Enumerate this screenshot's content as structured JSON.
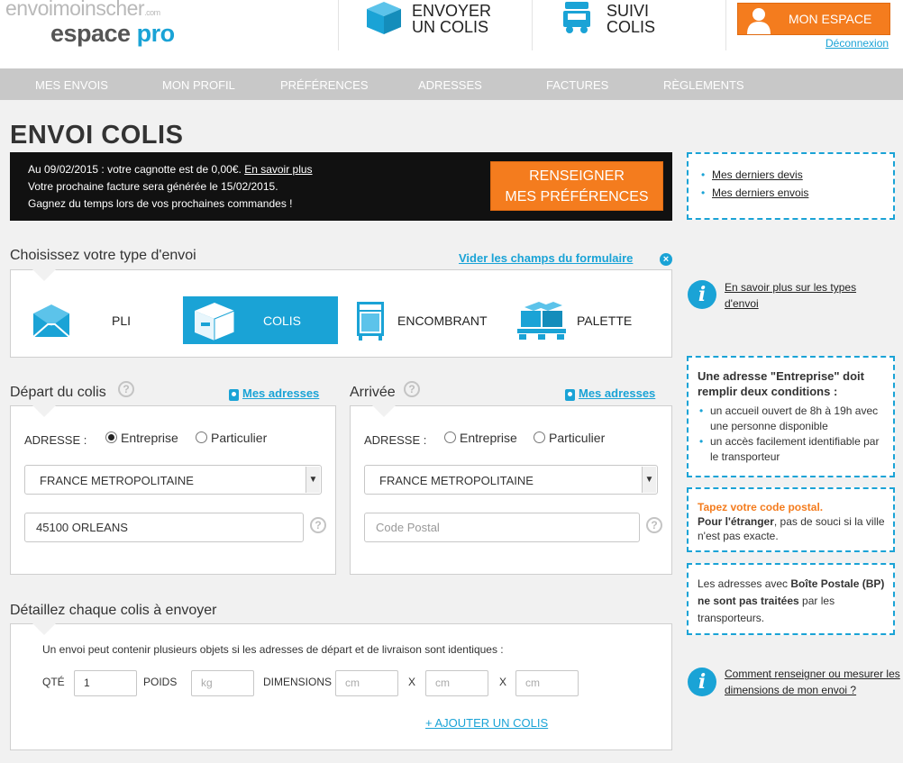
{
  "header": {
    "logo_top": "envoimoinscher",
    "logo_com": ".com",
    "logo_espace": "espace ",
    "logo_pro": "pro",
    "send_line1": "ENVOYER",
    "send_line2": "UN COLIS",
    "track_line1": "SUIVI",
    "track_line2": "COLIS",
    "account_button": "MON ESPACE",
    "logout": "Déconnexion"
  },
  "nav": {
    "items": [
      "MES ENVOIS",
      "MON PROFIL",
      "PRÉFÉRENCES",
      "ADRESSES",
      "FACTURES",
      "RÈGLEMENTS"
    ]
  },
  "page": {
    "title": "ENVOI COLIS"
  },
  "banner": {
    "line1_prefix": "Au 09/02/2015 : votre cagnotte est de 0,00€. ",
    "line1_link": "En savoir plus",
    "line2": "Votre prochaine facture sera générée le 15/02/2015.",
    "line3": "Gagnez du temps lors de vos prochaines commandes !",
    "button_line1": "RENSEIGNER",
    "button_line2": "MES PRÉFÉRENCES"
  },
  "sidebar": {
    "links": [
      "Mes derniers devis",
      "Mes derniers envois"
    ],
    "types_info": "En savoir plus sur les types d'envoi",
    "enterprise_title": "Une adresse \"Entreprise\" doit remplir deux conditions :",
    "enterprise_items": [
      "un accueil ouvert de 8h à 19h avec une personne disponible",
      "un accès facilement identifiable par le transporteur"
    ],
    "postal_title": "Tapez votre code postal.",
    "postal_bold": "Pour l'étranger",
    "postal_rest": ", pas de souci si la ville n'est pas exacte.",
    "bp_prefix": "Les adresses avec ",
    "bp_bold": "Boîte Postale (BP) ne sont pas traitées",
    "bp_suffix": " par les transporteurs.",
    "dimensions_info": "Comment renseigner ou mesurer les dimensions de mon envoi ?"
  },
  "shipment_type": {
    "title": "Choisissez votre type d'envoi",
    "reset_link": "Vider les champs du formulaire",
    "types": [
      "PLI",
      "COLIS",
      "ENCOMBRANT",
      "PALETTE"
    ],
    "selected": "COLIS"
  },
  "departure": {
    "title": "Départ du colis",
    "addresses_link": "Mes adresses",
    "address_label": "ADRESSE :",
    "option_company": "Entreprise",
    "option_private": "Particulier",
    "selected": "Entreprise",
    "country": "FRANCE METROPOLITAINE",
    "postal_value": "45100 ORLEANS"
  },
  "arrival": {
    "title": "Arrivée",
    "addresses_link": "Mes adresses",
    "address_label": "ADRESSE :",
    "option_company": "Entreprise",
    "option_private": "Particulier",
    "country": "FRANCE METROPOLITAINE",
    "postal_placeholder": "Code Postal"
  },
  "parcels": {
    "title": "Détaillez chaque colis à envoyer",
    "note": "Un envoi peut contenir plusieurs objets si les adresses de départ et de livraison sont identiques :",
    "qty_label": "QTÉ",
    "qty_value": "1",
    "weight_label": "POIDS",
    "weight_placeholder": "kg",
    "dimensions_label": "DIMENSIONS",
    "dim_placeholder": "cm",
    "times": "X",
    "add_link": "+ AJOUTER UN COLIS"
  },
  "colors": {
    "accent_blue": "#1aa3d6",
    "accent_orange": "#f47c1e",
    "nav_gray": "#c8c8c8"
  }
}
